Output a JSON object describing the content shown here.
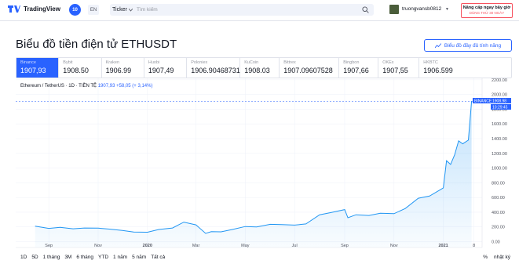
{
  "topbar": {
    "logo_text": "TradingView",
    "notif_count": "10",
    "lang": "EN",
    "ticker_label": "Ticker",
    "search_placeholder": "Tìm kiếm",
    "username": "truongvansb0812",
    "upgrade_line1": "Nâng cấp ngay bây giờ",
    "upgrade_line2": "DÙNG THỬ 30 NGÀY"
  },
  "page": {
    "title": "Biểu đồ tiền điện tử ETHUSDT",
    "fullchart_label": "Biểu đồ đầy đủ tính năng"
  },
  "exchanges": [
    {
      "name": "Binance",
      "price": "1907,93"
    },
    {
      "name": "Bybit",
      "price": "1908.50"
    },
    {
      "name": "Kraken",
      "price": "1906.99"
    },
    {
      "name": "Huobi",
      "price": "1907,49"
    },
    {
      "name": "Poloniex",
      "price": "1906.90468731"
    },
    {
      "name": "KuCoin",
      "price": "1908.03"
    },
    {
      "name": "Bittrex",
      "price": "1907.09607528"
    },
    {
      "name": "Bingbon",
      "price": "1907,66"
    },
    {
      "name": "OKEx",
      "price": "1907,55"
    },
    {
      "name": "HKBTC",
      "price": "1906.599"
    }
  ],
  "legend": {
    "symbol": "Ethereum / TetherUS · 1D · TIỀN TỆ",
    "price": "1907,93",
    "change": "+58,05 (+ 3,14%)"
  },
  "price_tag": {
    "label": "BINANCE",
    "price": "1908.98",
    "time": "10:29:45"
  },
  "periods": [
    "1D",
    "5D",
    "1 tháng",
    "3M",
    "6 tháng",
    "YTD",
    "1 năm",
    "5 năm",
    "Tất cả"
  ],
  "scale_controls": [
    "%",
    "nhật ký"
  ],
  "colors": {
    "accent": "#2962ff",
    "line": "#2196f3"
  },
  "chart_data": {
    "type": "area",
    "series": [
      {
        "name": "",
        "x": [
          "2019-08-15",
          "2019-09-01",
          "2019-09-15",
          "2019-10-01",
          "2019-10-15",
          "2019-11-01",
          "2019-11-15",
          "2019-12-01",
          "2019-12-15",
          "2020-01-01",
          "2020-01-15",
          "2020-02-01",
          "2020-02-15",
          "2020-03-01",
          "2020-03-13",
          "2020-03-20",
          "2020-04-01",
          "2020-04-15",
          "2020-05-01",
          "2020-05-15",
          "2020-06-01",
          "2020-06-15",
          "2020-07-01",
          "2020-07-15",
          "2020-08-01",
          "2020-08-15",
          "2020-09-01",
          "2020-09-05",
          "2020-09-15",
          "2020-10-01",
          "2020-10-15",
          "2020-11-01",
          "2020-11-15",
          "2020-12-01",
          "2020-12-15",
          "2021-01-01",
          "2021-01-05",
          "2021-01-10",
          "2021-01-15",
          "2021-01-20",
          "2021-01-25",
          "2021-02-01",
          "2021-02-05"
        ],
        "values": [
          210,
          180,
          195,
          175,
          185,
          183,
          170,
          152,
          130,
          128,
          165,
          185,
          265,
          228,
          112,
          135,
          133,
          165,
          205,
          200,
          235,
          232,
          225,
          240,
          365,
          395,
          435,
          325,
          365,
          355,
          385,
          380,
          450,
          590,
          620,
          730,
          1100,
          1050,
          1180,
          1370,
          1330,
          1380,
          1908
        ]
      }
    ],
    "x_ticks": [
      "Sep",
      "Nov",
      "2020",
      "Mar",
      "May",
      "Jul",
      "Sep",
      "Nov",
      "2021",
      "8"
    ],
    "y_ticks": [
      "0.00",
      "200.00",
      "400.00",
      "600.00",
      "800.00",
      "1000.00",
      "1200.00",
      "1400.00",
      "1600.00",
      "1800.00",
      "2000.00",
      "2200.00"
    ],
    "ylim": [
      -80,
      2220
    ],
    "grid": true,
    "legend_position": "top-left"
  }
}
